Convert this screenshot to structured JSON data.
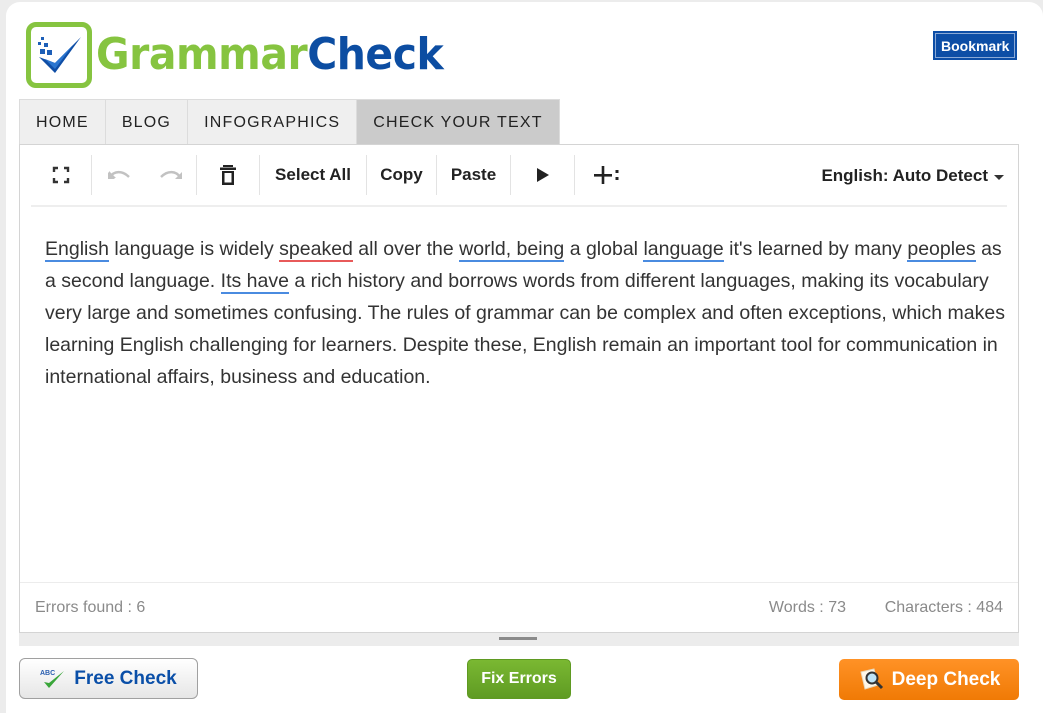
{
  "logo": {
    "part1": "Grammar",
    "part2": "Check"
  },
  "header": {
    "bookmark_label": "Bookmark"
  },
  "nav": {
    "items": [
      {
        "label": "HOME"
      },
      {
        "label": "BLOG"
      },
      {
        "label": "INFOGRAPHICS"
      },
      {
        "label": "CHECK YOUR TEXT",
        "active": true
      }
    ]
  },
  "toolbar": {
    "fullscreen_icon": "fullscreen-icon",
    "undo_icon": "undo-icon",
    "redo_icon": "redo-icon",
    "delete_icon": "trash-icon",
    "select_all_label": "Select All",
    "copy_label": "Copy",
    "paste_label": "Paste",
    "play_icon": "play-icon",
    "add_icon": "plus-more-icon",
    "language_label": "English: Auto Detect"
  },
  "content": {
    "segments": [
      {
        "text": "English",
        "error": "blue"
      },
      {
        "text": " language is widely "
      },
      {
        "text": "speaked",
        "error": "red"
      },
      {
        "text": " all over the "
      },
      {
        "text": "world, being",
        "error": "blue"
      },
      {
        "text": " a global "
      },
      {
        "text": "language",
        "error": "blue"
      },
      {
        "text": " it's learned by many "
      },
      {
        "text": "peoples",
        "error": "blue"
      },
      {
        "text": " as a second language. "
      },
      {
        "text": "Its have",
        "error": "blue"
      },
      {
        "text": " a rich history and borrows words from different languages, making its vocabulary very large and sometimes confusing. The rules of grammar can be complex and often exceptions, which makes learning English challenging for learners. Despite these, English remain an important tool for communication in international affairs, business and education."
      }
    ]
  },
  "status": {
    "errors": "Errors found : 6",
    "words": "Words : 73",
    "characters": "Characters : 484"
  },
  "actions": {
    "free_check": "Free Check",
    "fix_errors": "Fix Errors",
    "deep_check": "Deep Check"
  },
  "colors": {
    "brand_green": "#86c440",
    "brand_blue": "#0c4da2",
    "error_blue": "#4a8be0",
    "error_red": "#e85a5a",
    "fix_green": "#6aa82b",
    "deep_orange": "#f7851a"
  }
}
